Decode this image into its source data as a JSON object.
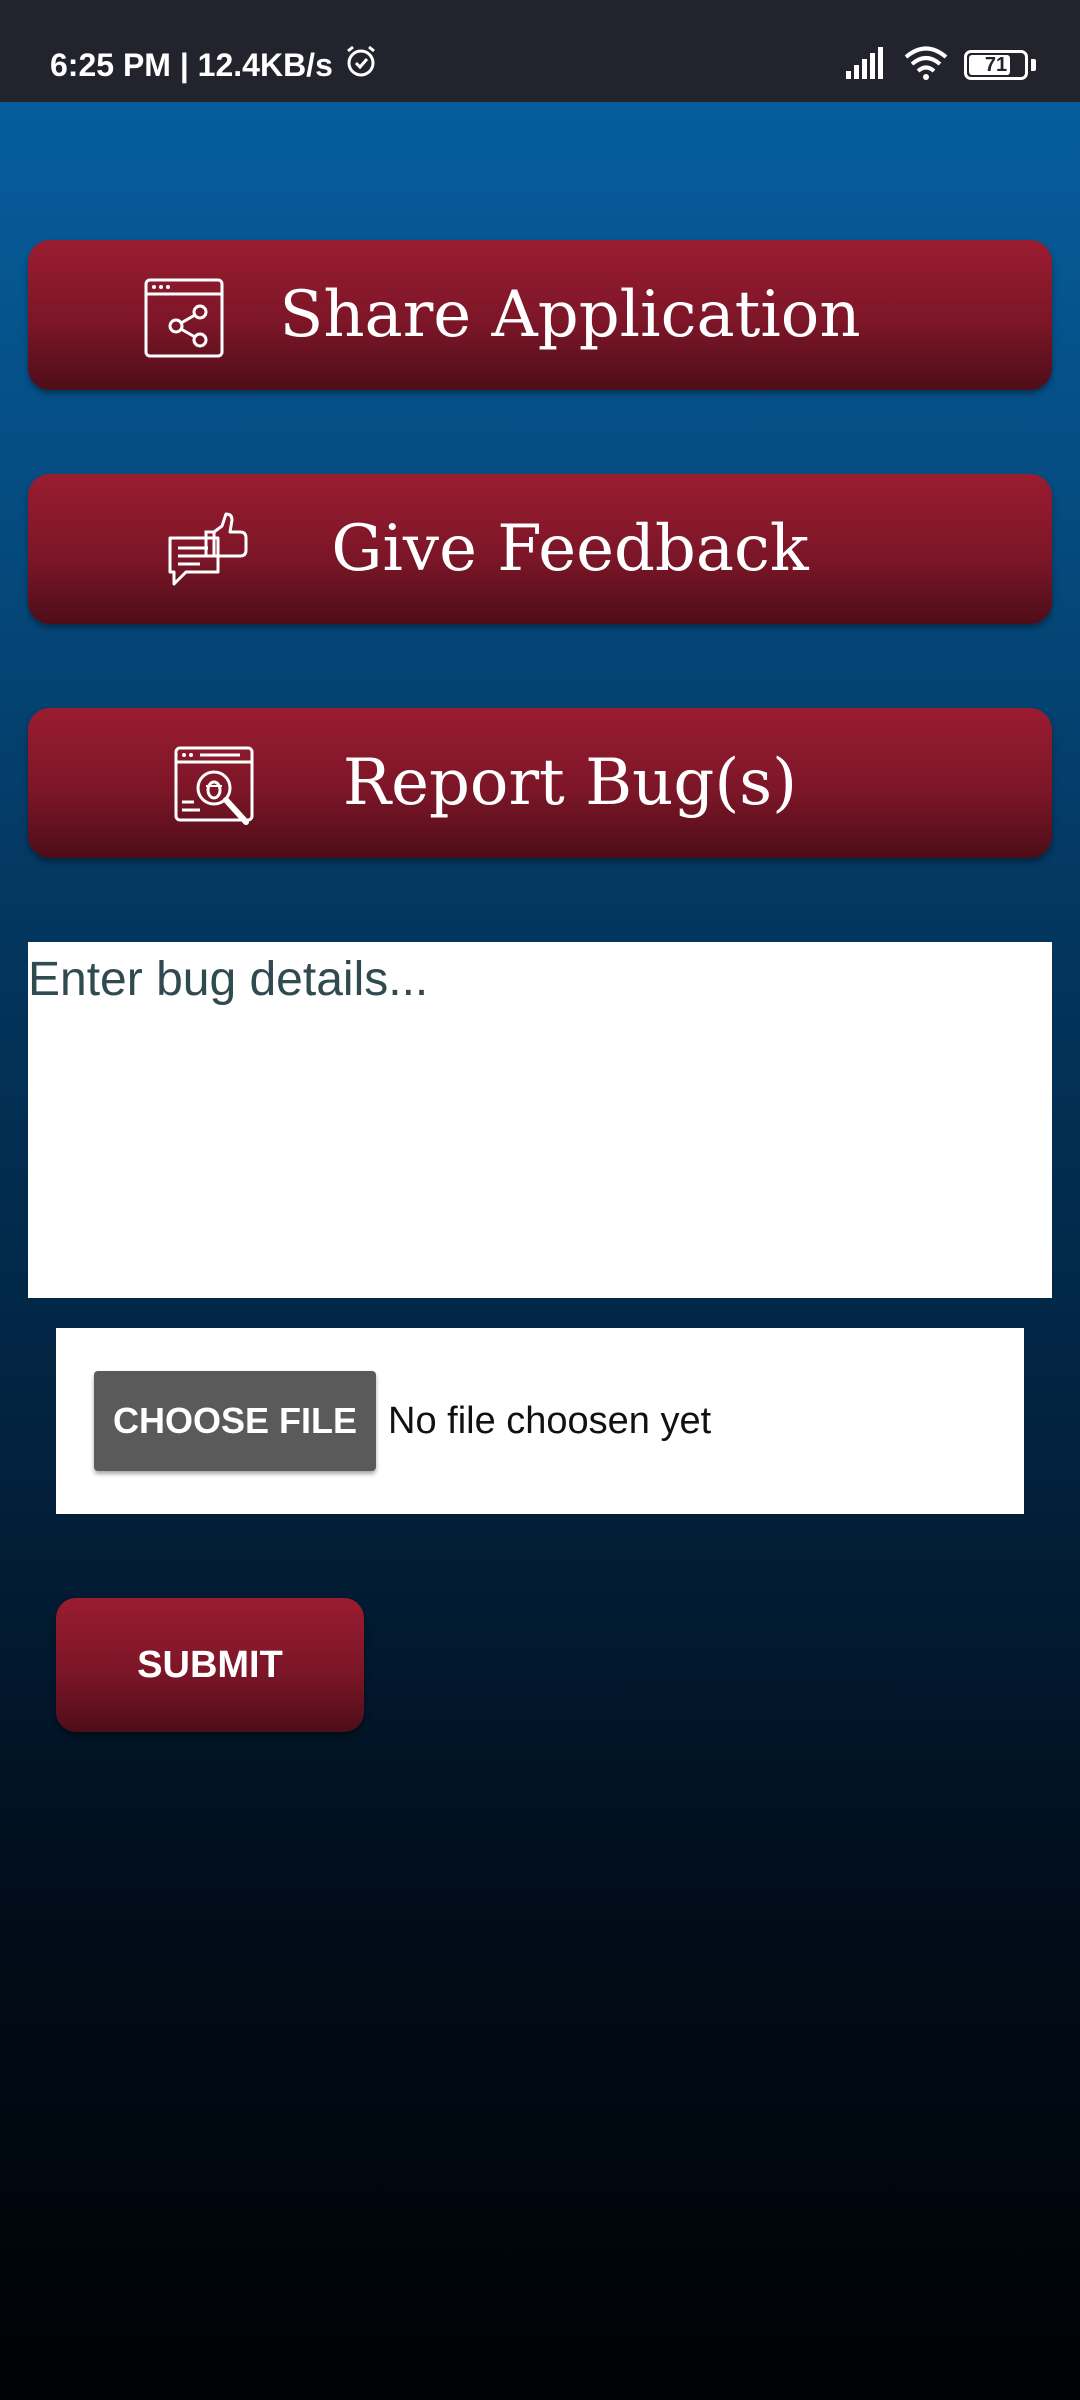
{
  "status_bar": {
    "time_speed": "6:25 PM | 12.4KB/s",
    "battery_level": "71",
    "icons": [
      "alarm-icon",
      "signal-icon",
      "wifi-icon",
      "battery-icon"
    ]
  },
  "actions": {
    "share_label": "Share Application",
    "feedback_label": "Give Feedback",
    "bug_label": "Report Bug(s)",
    "share_icon": "share-window-icon",
    "feedback_icon": "feedback-thumbs-up-icon",
    "bug_icon": "bug-search-icon"
  },
  "bug_form": {
    "placeholder": "Enter bug details...",
    "value": "",
    "choose_file_label": "CHOOSE FILE",
    "file_status": "No file choosen yet",
    "submit_label": "SUBMIT"
  },
  "colors": {
    "button_red": "#8c1a2e",
    "status_bar_bg": "#22232d",
    "background_top": "#0662a4",
    "background_bottom": "#000204"
  }
}
